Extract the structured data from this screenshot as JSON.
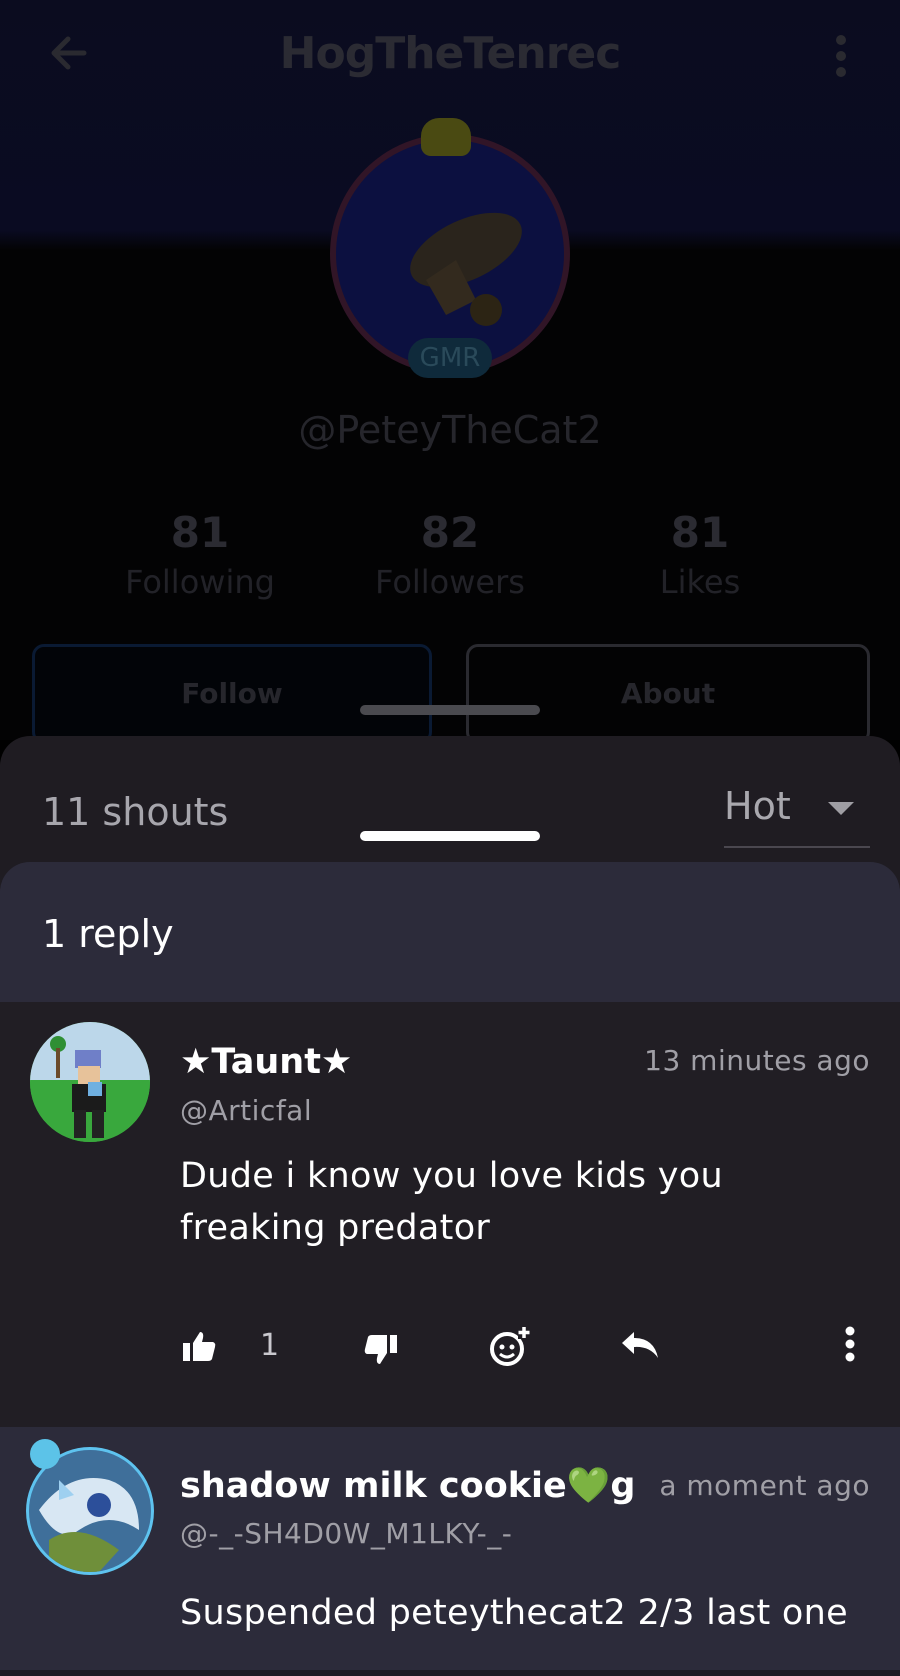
{
  "profile": {
    "title": "HogTheTenrec",
    "badge": "GMR",
    "handle": "@PeteyTheCat2",
    "stats": [
      {
        "value": "81",
        "label": "Following"
      },
      {
        "value": "82",
        "label": "Followers"
      },
      {
        "value": "81",
        "label": "Likes"
      }
    ],
    "follow_label": "Follow",
    "about_label": "About"
  },
  "shouts": {
    "count_label": "11 shouts",
    "sort_value": "Hot"
  },
  "replies": {
    "count_label": "1 reply",
    "comments": [
      {
        "display_name": "★Taunt★",
        "username": "@Articfal",
        "time": "13 minutes ago",
        "text": "Dude i know you love kids you freaking predator",
        "likes": "1"
      },
      {
        "display_name": "shadow milk cookie💚gre",
        "username": "@-_-SH4D0W_M1LKY-_-",
        "time": "a moment ago",
        "text": "Suspended peteythecat2 2/3 last one"
      }
    ]
  }
}
